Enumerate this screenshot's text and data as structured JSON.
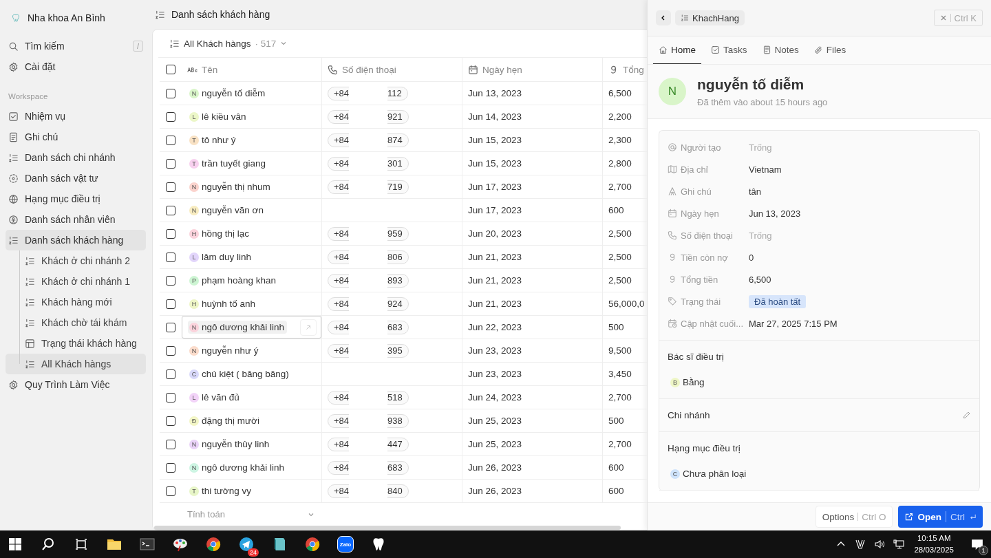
{
  "app": {
    "name": "Nha khoa An Bình"
  },
  "sidebar": {
    "top": [
      {
        "label": "Tìm kiếm",
        "kind": "search",
        "shortcut": "/"
      },
      {
        "label": "Cài đặt",
        "kind": "gear"
      }
    ],
    "section": "Workspace",
    "items": [
      {
        "label": "Nhiệm vụ",
        "kind": "check",
        "selected": false
      },
      {
        "label": "Ghi chú",
        "kind": "note",
        "selected": false
      },
      {
        "label": "Danh sách chi nhánh",
        "kind": "list",
        "selected": false
      },
      {
        "label": "Danh sách vật tư",
        "kind": "dashed",
        "selected": false
      },
      {
        "label": "Hạng mục điều trị",
        "kind": "globe",
        "selected": false
      },
      {
        "label": "Danh sách nhân viên",
        "kind": "person",
        "selected": false
      },
      {
        "label": "Danh sách khách hàng",
        "kind": "list",
        "selected": true,
        "children": [
          {
            "label": "Khách ở chi nhánh 2",
            "kind": "list",
            "selected": false
          },
          {
            "label": "Khách ở chi nhánh 1",
            "kind": "list",
            "selected": false
          },
          {
            "label": "Khách hàng mới",
            "kind": "list",
            "selected": false
          },
          {
            "label": "Khách chờ tái khám",
            "kind": "list",
            "selected": false
          },
          {
            "label": "Trạng thái khách hàng",
            "kind": "table",
            "selected": false
          },
          {
            "label": "All Khách hàngs",
            "kind": "list",
            "selected": true
          }
        ]
      },
      {
        "label": "Quy Trình Làm Việc",
        "kind": "gear",
        "selected": false
      }
    ]
  },
  "page_title": "Danh sách khách hàng",
  "view": {
    "name": "All Khách hàngs",
    "count": "· 517"
  },
  "table": {
    "all_checked": false,
    "columns": [
      {
        "label": "Tên",
        "kind": "abc"
      },
      {
        "label": "Số điện thoại",
        "kind": "phone"
      },
      {
        "label": "Ngày hẹn",
        "kind": "calendar"
      },
      {
        "label": "Tổng",
        "kind": "number"
      }
    ],
    "rows": [
      {
        "checked": false,
        "initial": "N",
        "color": "#d9f5c9",
        "name": "nguyễn tố diễm",
        "phone_prefix": "+84",
        "phone_suffix": "112",
        "date": "Jun 13, 2023",
        "total": "6,500",
        "hovered": false
      },
      {
        "checked": false,
        "initial": "L",
        "color": "#ecf7c8",
        "name": "lê kiều vân",
        "phone_prefix": "+84",
        "phone_suffix": "921",
        "date": "Jun 14, 2023",
        "total": "2,200",
        "hovered": false
      },
      {
        "checked": false,
        "initial": "T",
        "color": "#f9e2c4",
        "name": "tô như ý",
        "phone_prefix": "+84",
        "phone_suffix": "874",
        "date": "Jun 15, 2023",
        "total": "2,300",
        "hovered": false
      },
      {
        "checked": false,
        "initial": "T",
        "color": "#f8d0ef",
        "name": "trần tuyết giang",
        "phone_prefix": "+84",
        "phone_suffix": "301",
        "date": "Jun 15, 2023",
        "total": "2,800",
        "hovered": false
      },
      {
        "checked": false,
        "initial": "N",
        "color": "#fbd3cd",
        "name": "nguyễn thị nhum",
        "phone_prefix": "+84",
        "phone_suffix": "719",
        "date": "Jun 17, 2023",
        "total": "2,700",
        "hovered": false
      },
      {
        "checked": false,
        "initial": "N",
        "color": "#f8ecc0",
        "name": "nguyễn văn ơn",
        "date": "Jun 17, 2023",
        "total": "600",
        "hovered": false
      },
      {
        "checked": false,
        "initial": "H",
        "color": "#fbd3dc",
        "name": "hồng thị lạc",
        "phone_prefix": "+84",
        "phone_suffix": "959",
        "date": "Jun 20, 2023",
        "total": "2,500",
        "hovered": false
      },
      {
        "checked": false,
        "initial": "L",
        "color": "#e2d5fb",
        "name": "lâm duy linh",
        "phone_prefix": "+84",
        "phone_suffix": "806",
        "date": "Jun 21, 2023",
        "total": "2,500",
        "hovered": false
      },
      {
        "checked": false,
        "initial": "P",
        "color": "#cdf5d3",
        "name": "phạm hoàng khan",
        "phone_prefix": "+84",
        "phone_suffix": "893",
        "date": "Jun 21, 2023",
        "total": "2,500",
        "hovered": false
      },
      {
        "checked": false,
        "initial": "H",
        "color": "#eef6c6",
        "name": "huỳnh tố anh",
        "phone_prefix": "+84",
        "phone_suffix": "924",
        "date": "Jun 21, 2023",
        "total": "56,000,0",
        "hovered": false
      },
      {
        "checked": false,
        "initial": "N",
        "color": "#fbd3dc",
        "name": "ngô dương khải linh",
        "phone_prefix": "+84",
        "phone_suffix": "683",
        "date": "Jun 22, 2023",
        "total": "500",
        "hovered": true
      },
      {
        "checked": false,
        "initial": "N",
        "color": "#fbdccb",
        "name": "nguyễn như ý",
        "phone_prefix": "+84",
        "phone_suffix": "395",
        "date": "Jun 23, 2023",
        "total": "9,500",
        "hovered": false
      },
      {
        "checked": false,
        "initial": "C",
        "color": "#d9d9fb",
        "name": "chú kiệt ( băng băng)",
        "date": "Jun 23, 2023",
        "total": "3,450",
        "hovered": false
      },
      {
        "checked": false,
        "initial": "L",
        "color": "#f2d3f8",
        "name": "lê văn đủ",
        "phone_prefix": "+84",
        "phone_suffix": "518",
        "date": "Jun 24, 2023",
        "total": "2,700",
        "hovered": false
      },
      {
        "checked": false,
        "initial": "Đ",
        "color": "#f3f6c6",
        "name": "đặng thị mười",
        "phone_prefix": "+84",
        "phone_suffix": "938",
        "date": "Jun 25, 2023",
        "total": "500",
        "hovered": false
      },
      {
        "checked": false,
        "initial": "N",
        "color": "#ead3f8",
        "name": "nguyễn thùy linh",
        "phone_prefix": "+84",
        "phone_suffix": "447",
        "date": "Jun 25, 2023",
        "total": "2,700",
        "hovered": false
      },
      {
        "checked": false,
        "initial": "N",
        "color": "#cdf5e3",
        "name": "ngô dương khải linh",
        "phone_prefix": "+84",
        "phone_suffix": "683",
        "date": "Jun 26, 2023",
        "total": "600",
        "hovered": false
      },
      {
        "checked": false,
        "initial": "T",
        "color": "#e8f6c8",
        "name": "thi tường vy",
        "phone_prefix": "+84",
        "phone_suffix": "840",
        "date": "Jun 26, 2023",
        "total": "600",
        "hovered": false
      }
    ],
    "footer": "Tính toán"
  },
  "panel": {
    "breadcrumb": "KhachHang",
    "close_shortcut": "Ctrl K",
    "tabs": [
      {
        "label": "Home",
        "kind": "home",
        "selected": true
      },
      {
        "label": "Tasks",
        "kind": "check",
        "selected": false
      },
      {
        "label": "Notes",
        "kind": "note",
        "selected": false
      },
      {
        "label": "Files",
        "kind": "clip",
        "selected": false
      }
    ],
    "record": {
      "initial": "N",
      "color": "#d9f5c9",
      "name": "nguyễn tố diễm",
      "subtitle": "Đã thêm vào about 15 hours ago"
    },
    "fields": [
      {
        "label": "Người tạo",
        "placeholder": "Trống"
      },
      {
        "label": "Địa chỉ",
        "value": "Vietnam",
        "kind": "text"
      },
      {
        "label": "Ghi chú",
        "value": "tân",
        "kind": "text"
      },
      {
        "label": "Ngày hẹn",
        "value": "Jun 13, 2023",
        "kind": "text"
      },
      {
        "label": "Số điện thoại",
        "placeholder": "Trống"
      },
      {
        "label": "Tiền còn nợ",
        "value": "0",
        "kind": "text"
      },
      {
        "label": "Tổng tiền",
        "value": "6,500",
        "kind": "text"
      },
      {
        "label": "Trạng thái",
        "value": "Đã hoàn tất",
        "kind": "tag"
      },
      {
        "label": "Cập nhật cuối...",
        "value": "Mar 27, 2025 7:15 PM",
        "kind": "text"
      }
    ],
    "sections": [
      {
        "title": "Bác sĩ điều trị",
        "editable": false,
        "chips": [
          {
            "initial": "B",
            "color": "#eef6c6",
            "label": "Bằng"
          }
        ]
      },
      {
        "title": "Chi nhánh",
        "editable": true
      },
      {
        "title": "Hạng mục điều trị",
        "editable": false,
        "chips": [
          {
            "initial": "C",
            "color": "#cfe3fb",
            "label": "Chưa phân loại"
          }
        ]
      }
    ],
    "options": {
      "label": "Options",
      "shortcut": "Ctrl O"
    },
    "open": {
      "label": "Open",
      "shortcut": "Ctrl"
    }
  },
  "taskbar": {
    "apps": [
      {
        "kind": "folder"
      },
      {
        "kind": "terminal"
      },
      {
        "kind": "paint"
      },
      {
        "kind": "chrome"
      },
      {
        "kind": "telegram",
        "badge": "24"
      },
      {
        "kind": "notes"
      },
      {
        "kind": "chrome"
      },
      {
        "kind": "zalo",
        "label": "Zalo"
      },
      {
        "kind": "tooth"
      }
    ],
    "time": "10:15 AM",
    "date": "28/03/2025",
    "notifications": "1"
  }
}
